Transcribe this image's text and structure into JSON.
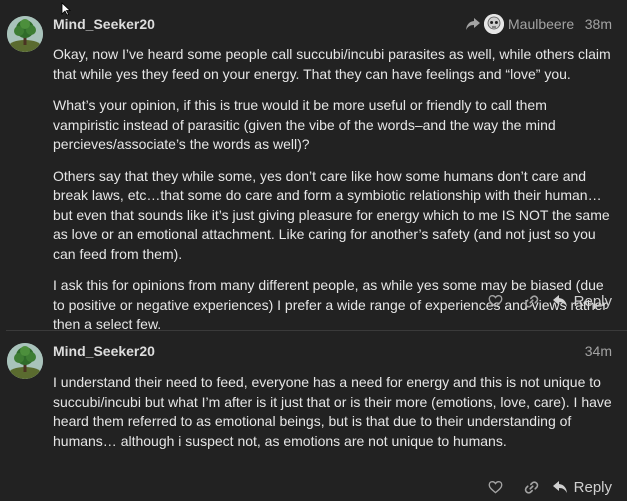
{
  "posts": [
    {
      "username": "Mind_Seeker20",
      "time": "38m",
      "reply_to": {
        "name": "Maulbeere",
        "icon": "reply-arrow-icon"
      },
      "paragraphs": [
        "Okay, now I’ve heard some people call succubi/incubi parasites as well, while others claim that while yes they feed on your energy. That they can have feelings and “love” you.",
        "What’s your opinion, if this is true would it be more useful or friendly to call them vampiristic instead of parasitic (given the vibe of the words–and the way the mind percieves/associate’s the words as well)?",
        "Others say that they while some, yes don’t care like how some humans don’t care and break laws, etc…that some do care and form a symbiotic relationship with their human…but even that sounds like it’s just giving pleasure for energy which to me IS NOT the same as love or an emotional attachment. Like caring for another’s safety (and not just so you can feed from them).",
        "I ask this for opinions from many different people, as while yes some may be biased (due to positive or negative experiences) I prefer a wide range of experiences and views rather then a select few."
      ],
      "actions": {
        "like_icon": "heart-icon",
        "link_icon": "link-icon",
        "reply_label": "Reply"
      }
    },
    {
      "username": "Mind_Seeker20",
      "time": "34m",
      "paragraphs": [
        "I understand their need to feed, everyone has a need for energy and this is not unique to succubi/incubi but what I’m after is it just that or is their more (emotions, love, care). I have heard them referred to as emotional beings, but is that due to their understanding of humans… although i suspect not, as emotions are not unique to humans."
      ],
      "actions": {
        "like_icon": "heart-icon",
        "link_icon": "link-icon",
        "reply_label": "Reply"
      }
    }
  ],
  "colors": {
    "background": "#222222",
    "text": "#e6e6e6",
    "muted": "#a3a3a3",
    "divider": "#3a3a3a"
  }
}
